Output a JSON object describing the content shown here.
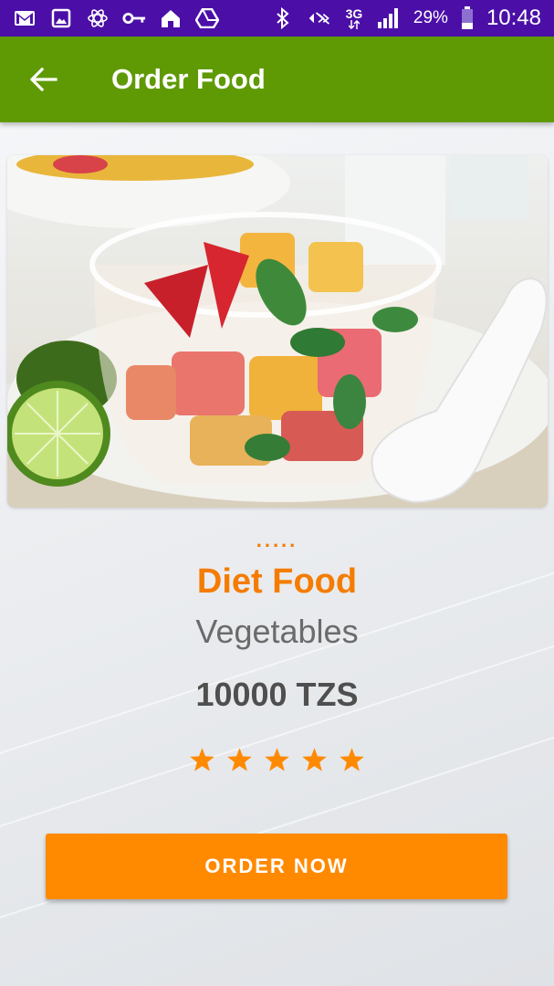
{
  "status_bar": {
    "network": "3G",
    "battery": "29%",
    "time": "10:48",
    "icons_left": [
      "gmail-icon",
      "gallery-icon",
      "atom-icon",
      "key-icon",
      "home-icon",
      "drive-icon"
    ],
    "icons_right": [
      "bluetooth-icon",
      "mute-icon",
      "signal-icon",
      "battery-icon"
    ]
  },
  "app_bar": {
    "title": "Order Food",
    "back_icon": "arrow-left-icon",
    "color": "#5f9a05"
  },
  "food": {
    "dots": ".....",
    "name": "Diet Food",
    "category": "Vegetables",
    "price": "10000 TZS",
    "rating": 5,
    "rating_max": 5,
    "image": "fruit-salad-bowl-image"
  },
  "actions": {
    "order_label": "ORDER NOW"
  },
  "colors": {
    "accent": "#ff8a00",
    "status_bar": "#4b0fa8",
    "app_bar": "#5f9a05"
  }
}
